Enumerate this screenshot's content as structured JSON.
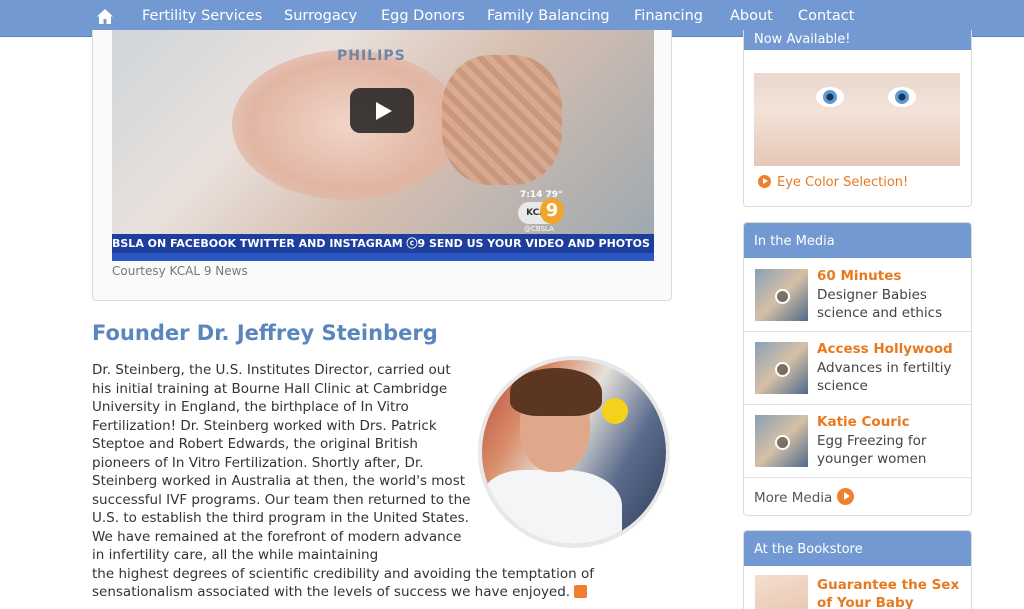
{
  "nav": {
    "home_icon": "home-icon",
    "items": [
      "Fertility Services",
      "Surrogacy",
      "Egg Donors",
      "Family Balancing",
      "Financing",
      "About",
      "Contact"
    ]
  },
  "video": {
    "brand_text": "PHILIPS",
    "time": "7:14 79°",
    "station_logo": "KCAL",
    "station_number": "9",
    "social_handle": "@CBSLA",
    "ticker": "BSLA ON FACEBOOK TWITTER AND INSTAGRAM   ⓒ9  SEND US YOUR VIDEO AND PHOTOS U",
    "caption": "Courtesy KCAL 9 News"
  },
  "founder": {
    "title": "Founder Dr. Jeffrey Steinberg",
    "bio_part1": "Dr. Steinberg, the U.S. Institutes Director, carried out his initial training at Bourne Hall Clinic at Cambridge University in England, the birthplace of In Vitro Fertilization! Dr. Steinberg worked with Drs. Patrick Steptoe and Robert Edwards, the original British pioneers of In Vitro Fertilization. Shortly after, Dr. Steinberg worked in Australia at then, the world's most successful IVF programs. Our team then returned to the U.S. to establish the third program in the United States. We have remained at the forefront of modern advance in infertility care, all the while maintaining",
    "bio_part2": "the highest degrees of scientific credibility and avoiding the temptation of sensationalism associated with the levels of success we have enjoyed."
  },
  "sidebar": {
    "now_available": {
      "heading": "Now Available!",
      "link": "Eye Color Selection!"
    },
    "media": {
      "heading": "In the Media",
      "items": [
        {
          "title": "60 Minutes",
          "desc": "Designer Babies science and ethics"
        },
        {
          "title": "Access Hollywood",
          "desc": "Advances in fertiltiy science"
        },
        {
          "title": "Katie Couric",
          "desc": "Egg Freezing for younger women"
        }
      ],
      "more": "More Media"
    },
    "bookstore": {
      "heading": "At the Bookstore",
      "item_title": "Guarantee the Sex of Your Baby"
    }
  },
  "colors": {
    "nav": "#7399d2",
    "accent": "#e8791f",
    "heading": "#5a86be"
  }
}
